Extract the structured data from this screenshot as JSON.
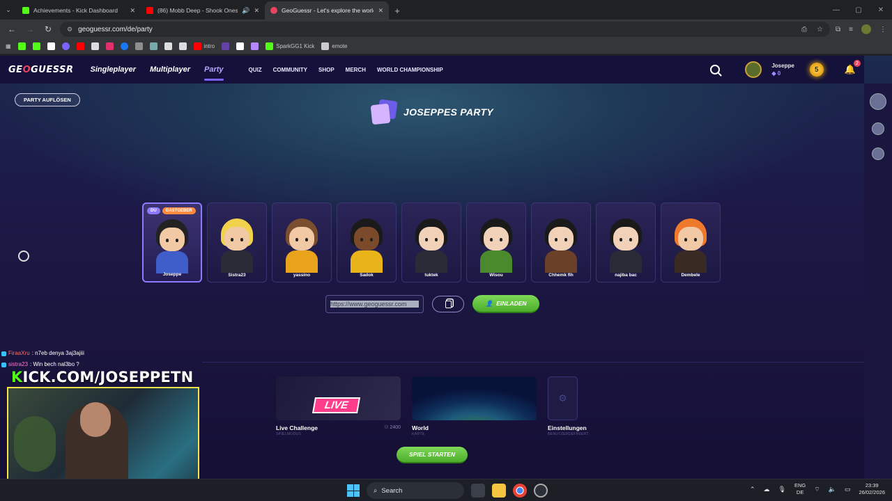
{
  "browser": {
    "tabs": [
      {
        "title": "Achievements - Kick Dashboard",
        "color": "#53fc18",
        "active": false
      },
      {
        "title": "(86) Mobb Deep - Shook Ones",
        "color": "#ff0000",
        "active": false
      },
      {
        "title": "GeoGuessr - Let's explore the world!",
        "color": "#e94560",
        "active": true
      }
    ],
    "url": "geoguessr.com/de/party",
    "bookmarks": [
      {
        "label": "",
        "color": "#53fc18"
      },
      {
        "label": "",
        "color": "#53fc18"
      },
      {
        "label": "",
        "color": "#fff"
      },
      {
        "label": "",
        "color": "#7a63ff"
      },
      {
        "label": "",
        "color": "#ff0000"
      },
      {
        "label": "",
        "color": "#ddd"
      },
      {
        "label": "",
        "color": "#e1306c"
      },
      {
        "label": "",
        "color": "#1877f2"
      },
      {
        "label": "",
        "color": "#8e8e8e"
      },
      {
        "label": "",
        "color": "#7aa"
      },
      {
        "label": "",
        "color": "#ddd"
      },
      {
        "label": "",
        "color": "#ddd"
      },
      {
        "label": "intro",
        "color": "#ff0000"
      },
      {
        "label": "",
        "color": "#6441a5"
      },
      {
        "label": "",
        "color": "#fff"
      },
      {
        "label": "",
        "color": "#b388ff"
      },
      {
        "label": "SparkGG1 Kick",
        "color": "#53fc18"
      },
      {
        "label": "emote",
        "color": "#ccc"
      }
    ]
  },
  "header": {
    "logo_pre": "GE",
    "logo_o": "O",
    "logo_post": "GUESSR",
    "main_nav": [
      "Singleplayer",
      "Multiplayer",
      "Party"
    ],
    "sub_nav": [
      "QUIZ",
      "COMMUNITY",
      "SHOP",
      "MERCH",
      "WORLD CHAMPIONSHIP"
    ],
    "username": "Joseppe",
    "coins": "0",
    "level": "5",
    "notifications": "2"
  },
  "party": {
    "disband_label": "PARTY AUFLÖSEN",
    "title": "JOSEPPES PARTY",
    "tag_you": "DU",
    "tag_host": "GASTGEBER",
    "players": [
      {
        "name": "Joseppe",
        "hair": "#222",
        "skin": "#f1c9a5",
        "shirt": "#3f5ec9",
        "me": true
      },
      {
        "name": "Sistra23",
        "hair": "#f2d24b",
        "skin": "#f1c9a5",
        "shirt": "#2b2b38",
        "me": false
      },
      {
        "name": "yassino",
        "hair": "#7a4e2e",
        "skin": "#f1c9a5",
        "shirt": "#e9a31a",
        "me": false
      },
      {
        "name": "Sadok",
        "hair": "#1a1a1a",
        "skin": "#7a4a2a",
        "shirt": "#e9b31a",
        "me": false
      },
      {
        "name": "tuktek",
        "hair": "#1a1a1a",
        "skin": "#f1d2b8",
        "shirt": "#2b2b38",
        "me": false
      },
      {
        "name": "Wisou",
        "hair": "#1a1a1a",
        "skin": "#f1d2b8",
        "shirt": "#4b8a2c",
        "me": false
      },
      {
        "name": "Chhemk flh",
        "hair": "#1a1a1a",
        "skin": "#f1d2b8",
        "shirt": "#6a4128",
        "me": false
      },
      {
        "name": "najiba bac",
        "hair": "#1a1a1a",
        "skin": "#f1d2b8",
        "shirt": "#2b2b38",
        "me": false
      },
      {
        "name": "Dembele",
        "hair": "#f07a2c",
        "skin": "#f1c9a5",
        "shirt": "#3a2a24",
        "me": false
      }
    ],
    "invite_url": "https://www.geoguessr.com",
    "invite_label": "EINLADEN"
  },
  "game": {
    "live": {
      "title": "Live Challenge",
      "sub": "SPIELMODUS",
      "badge": "LIVE",
      "count": "2400"
    },
    "world": {
      "title": "World",
      "sub": "KARTE"
    },
    "settings": {
      "title": "Einstellungen",
      "sub": "BENUTZERDEFINIERT"
    },
    "start_label": "SPIEL STARTEN"
  },
  "stream": {
    "chat": [
      {
        "user": "FiraaXru",
        "message": ": n7eb denya 3aj3ajiii",
        "color": "#ff6b6b"
      },
      {
        "user": "sistra23",
        "message": ": Win bech nal3bo ?",
        "color": "#ff7ad2"
      }
    ],
    "kick_k": "K",
    "kick_rest": "ICK.COM/JOSEPPETN"
  },
  "taskbar": {
    "search": "Search",
    "lang_top": "ENG",
    "lang_bottom": "DE",
    "time": "23:39",
    "date": "26/02/2026"
  }
}
